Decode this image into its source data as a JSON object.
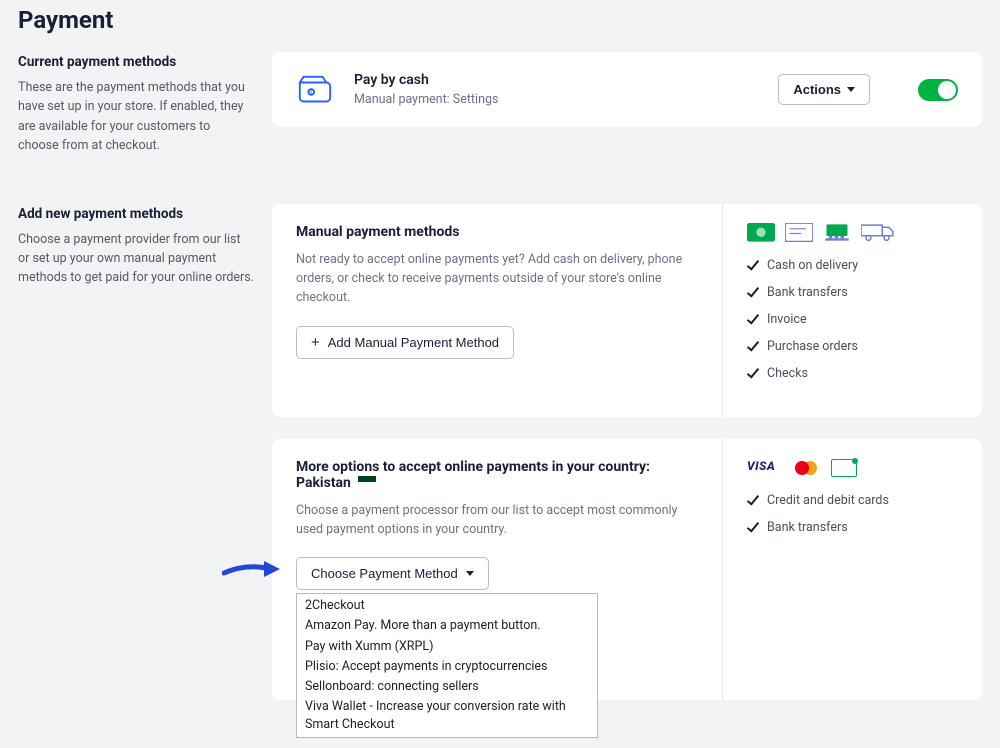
{
  "page_title": "Payment",
  "current_methods": {
    "heading": "Current payment methods",
    "desc": "These are the payment methods that you have set up in your store. If enabled, they are available for your customers to choose from at checkout.",
    "item": {
      "title": "Pay by cash",
      "subtitle": "Manual payment: Settings",
      "actions_label": "Actions"
    }
  },
  "add_new": {
    "heading": "Add new payment methods",
    "desc": "Choose a payment provider from our list or set up your own manual payment methods to get paid for your online orders.",
    "manual": {
      "title": "Manual payment methods",
      "desc": "Not ready to accept online payments yet? Add cash on delivery, phone orders, or check to receive payments outside of your store's online checkout.",
      "button": "Add Manual Payment Method",
      "features": [
        "Cash on delivery",
        "Bank transfers",
        "Invoice",
        "Purchase orders",
        "Checks"
      ]
    },
    "more": {
      "title_prefix": "More options to accept online payments in your country: ",
      "country": "Pakistan",
      "desc": "Choose a payment processor from our list to accept most commonly used payment options in your country.",
      "button": "Choose Payment Method",
      "features": [
        "Credit and debit cards",
        "Bank transfers"
      ],
      "dropdown": [
        "2Checkout",
        "Amazon Pay. More than a payment button.",
        "Pay with Xumm (XRPL)",
        "Plisio: Accept payments in cryptocurrencies",
        "Sellonboard: connecting sellers",
        "Viva Wallet - Increase your conversion rate with Smart Checkout"
      ]
    }
  }
}
